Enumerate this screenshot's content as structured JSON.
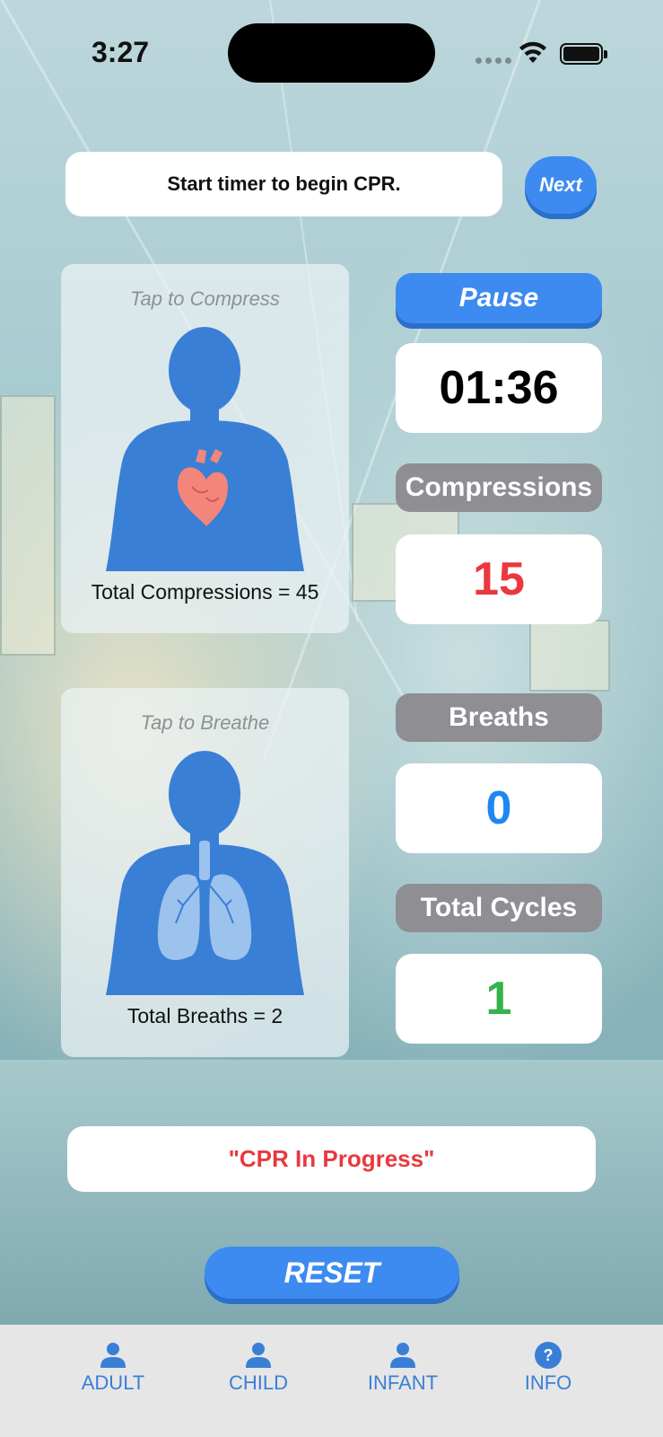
{
  "status_bar": {
    "time": "3:27"
  },
  "instruction": {
    "text": "Start timer to begin CPR."
  },
  "next_button": {
    "label": "Next"
  },
  "compress_panel": {
    "tap_label": "Tap to Compress",
    "total_label": "Total Compressions = 45"
  },
  "breathe_panel": {
    "tap_label": "Tap to Breathe",
    "total_label": "Total Breaths = 2"
  },
  "pause_button": {
    "label": "Pause"
  },
  "timer": {
    "value": "01:36"
  },
  "compressions": {
    "label": "Compressions",
    "value": "15",
    "color": "#e8393f"
  },
  "breaths": {
    "label": "Breaths",
    "value": "0",
    "color": "#1f87ef"
  },
  "total_cycles": {
    "label": "Total Cycles",
    "value": "1",
    "color": "#35b24a"
  },
  "cpr_status": {
    "text": "\"CPR In Progress\""
  },
  "reset_button": {
    "label": "RESET"
  },
  "tabs": [
    {
      "label": "ADULT",
      "icon": "person-icon"
    },
    {
      "label": "CHILD",
      "icon": "person-icon"
    },
    {
      "label": "INFANT",
      "icon": "person-icon"
    },
    {
      "label": "INFO",
      "icon": "question-circle-icon"
    }
  ],
  "colors": {
    "accent": "#3d8bf0",
    "pill_gray": "#8e8e93",
    "tab_tint": "#3a7fd6"
  }
}
